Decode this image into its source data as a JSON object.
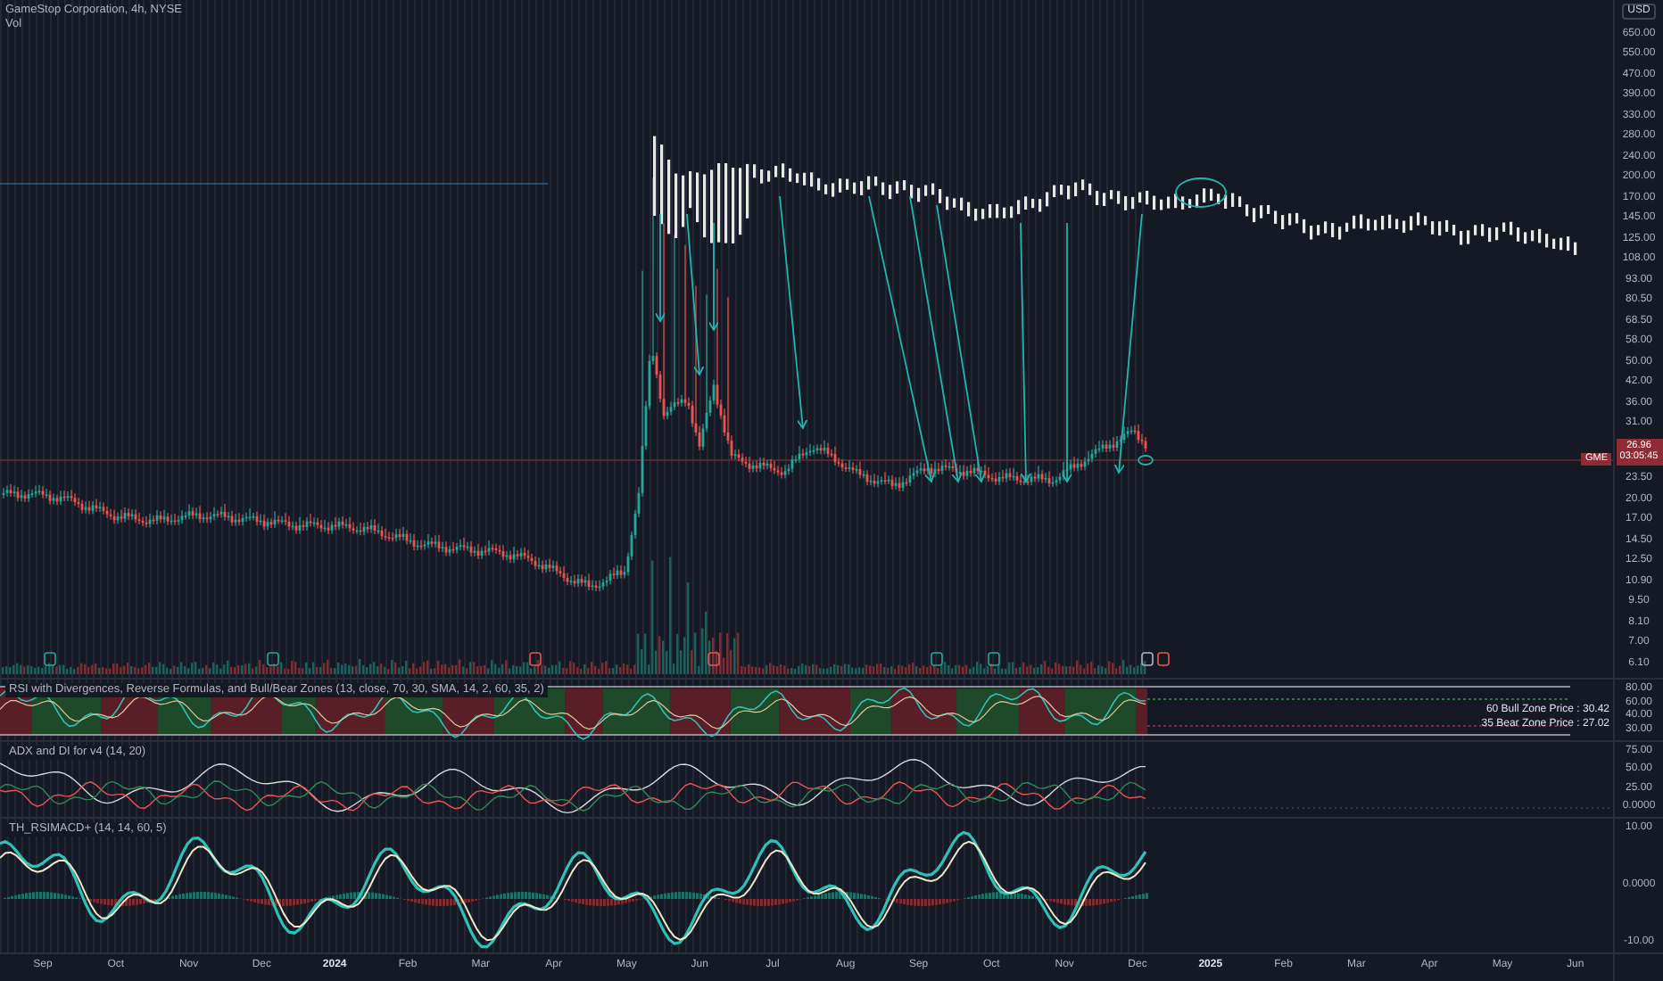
{
  "header": {
    "title": "GameStop Corporation, 4h, NYSE",
    "volume_label": "Vol"
  },
  "price_axis": {
    "currency": "USD",
    "ticks_above": [
      "650.00",
      "550.00",
      "470.00",
      "390.00",
      "330.00",
      "280.00",
      "240.00",
      "200.00",
      "170.00",
      "145.00",
      "125.00",
      "108.00",
      "93.00",
      "80.50",
      "68.50",
      "58.00",
      "50.00",
      "42.00",
      "36.00",
      "31.00"
    ],
    "current": {
      "symbol": "GME",
      "price": "26.96",
      "countdown": "03:05:45"
    },
    "ticks_below": [
      "23.50",
      "20.00",
      "17.00",
      "14.50",
      "12.50",
      "10.90",
      "9.50",
      "8.10",
      "7.00",
      "6.10"
    ]
  },
  "panes": [
    {
      "kind": "rsi",
      "legend": "RSI with Divergences, Reverse Formulas, and Bull/Bear Zones (13, close, 70, 30, SMA, 14, 2, 60, 35, 2)",
      "ticks": [
        "80.00",
        "60.00",
        "40.00",
        "30.00"
      ],
      "zone_labels": [
        "60 Bull Zone Price : 30.42",
        "35 Bear Zone Price : 27.02"
      ]
    },
    {
      "kind": "adx",
      "legend": "ADX and DI for v4 (14, 20)",
      "ticks": [
        "75.00",
        "50.00",
        "25.00",
        "0.0000"
      ]
    },
    {
      "kind": "macd",
      "legend": "TH_RSIMACD+ (14, 14, 60, 5)",
      "ticks": [
        "10.00",
        "0.0000",
        "-10.00"
      ]
    }
  ],
  "time_axis": [
    {
      "label": "Sep",
      "kind": "month"
    },
    {
      "label": "Oct",
      "kind": "month"
    },
    {
      "label": "Nov",
      "kind": "month"
    },
    {
      "label": "Dec",
      "kind": "month"
    },
    {
      "label": "2024",
      "kind": "year"
    },
    {
      "label": "Feb",
      "kind": "month"
    },
    {
      "label": "Mar",
      "kind": "month"
    },
    {
      "label": "Apr",
      "kind": "month"
    },
    {
      "label": "May",
      "kind": "month"
    },
    {
      "label": "Jun",
      "kind": "month"
    },
    {
      "label": "Jul",
      "kind": "month"
    },
    {
      "label": "Aug",
      "kind": "month"
    },
    {
      "label": "Sep",
      "kind": "month"
    },
    {
      "label": "Oct",
      "kind": "month"
    },
    {
      "label": "Nov",
      "kind": "month"
    },
    {
      "label": "Dec",
      "kind": "month"
    },
    {
      "label": "2025",
      "kind": "year"
    },
    {
      "label": "Feb",
      "kind": "month"
    },
    {
      "label": "Mar",
      "kind": "month"
    },
    {
      "label": "Apr",
      "kind": "month"
    },
    {
      "label": "May",
      "kind": "month"
    },
    {
      "label": "Jun",
      "kind": "month"
    }
  ]
}
